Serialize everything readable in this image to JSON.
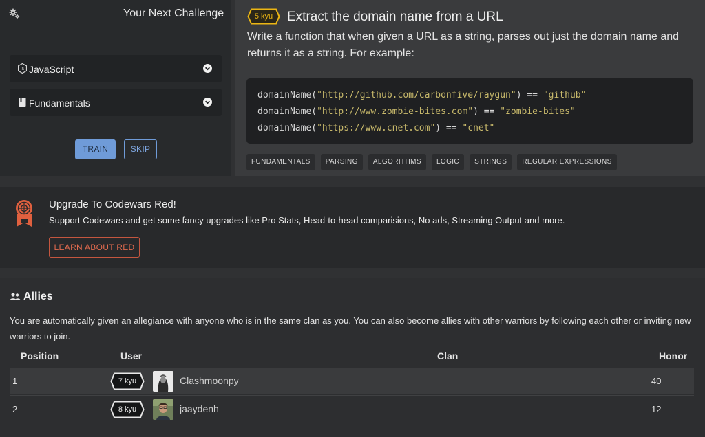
{
  "challenge": {
    "title": "Your Next Challenge",
    "language": "JavaScript",
    "focus": "Fundamentals",
    "train_label": "TRAIN",
    "skip_label": "SKIP"
  },
  "kata": {
    "rank": "5 kyu",
    "rank_color": "#ecb613",
    "title": "Extract the domain name from a URL",
    "description": "Write a function that when given a URL as a string, parses out just the domain name and returns it as a string. For example:",
    "code": [
      {
        "fn": "domainName(",
        "arg": "\"http://github.com/carbonfive/raygun\"",
        "mid": ") == ",
        "res": "\"github\""
      },
      {
        "fn": "domainName(",
        "arg": "\"http://www.zombie-bites.com\"",
        "mid": ") == ",
        "res": "\"zombie-bites\""
      },
      {
        "fn": "domainName(",
        "arg": "\"https://www.cnet.com\"",
        "mid": ") == ",
        "res": "\"cnet\""
      }
    ],
    "tags": [
      "FUNDAMENTALS",
      "PARSING",
      "ALGORITHMS",
      "LOGIC",
      "STRINGS",
      "REGULAR EXPRESSIONS"
    ]
  },
  "red": {
    "title": "Upgrade To Codewars Red!",
    "description": "Support Codewars and get some fancy upgrades like Pro Stats, Head-to-head comparisions, No ads, Streaming Output and more.",
    "button_label": "LEARN ABOUT RED",
    "accent_color": "#e06a4e"
  },
  "allies": {
    "title": "Allies",
    "description": "You are automatically given an allegiance with anyone who is in the same clan as you. You can also become allies with other warriors by following each other or inviting new warriors to join.",
    "columns": [
      "Position",
      "User",
      "Clan",
      "Honor"
    ],
    "rows": [
      {
        "position": "1",
        "rank": "7 kyu",
        "user": "Clashmoonpy",
        "clan": "",
        "honor": "40"
      },
      {
        "position": "2",
        "rank": "8 kyu",
        "user": "jaaydenh",
        "clan": "",
        "honor": "12"
      }
    ]
  }
}
